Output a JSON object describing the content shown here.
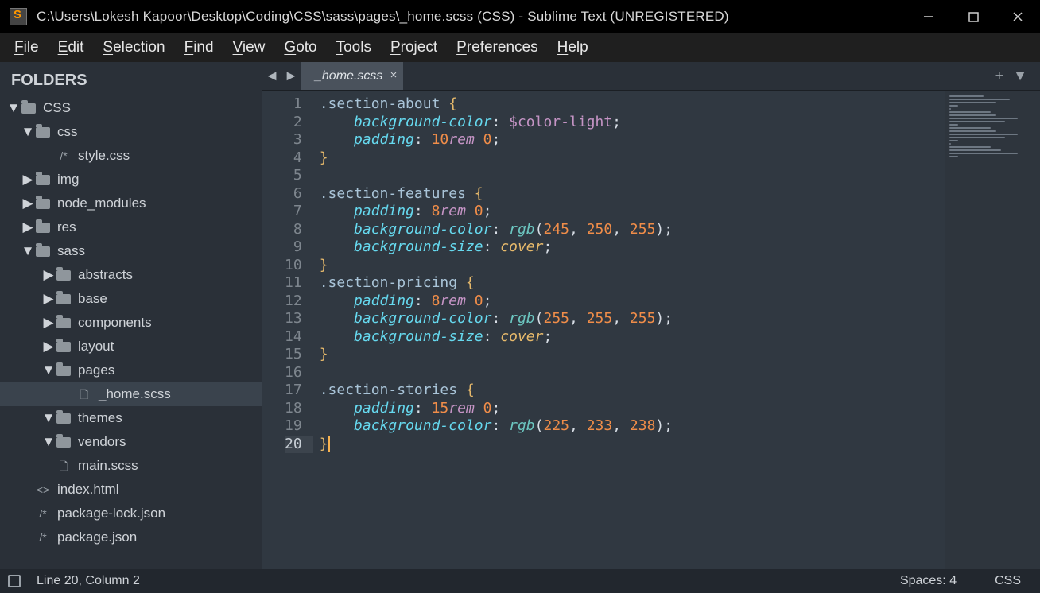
{
  "title": "C:\\Users\\Lokesh Kapoor\\Desktop\\Coding\\CSS\\sass\\pages\\_home.scss (CSS) - Sublime Text (UNREGISTERED)",
  "menu": [
    "File",
    "Edit",
    "Selection",
    "Find",
    "View",
    "Goto",
    "Tools",
    "Project",
    "Preferences",
    "Help"
  ],
  "sidebar": {
    "header": "FOLDERS",
    "tree": [
      {
        "d": 0,
        "k": "fo",
        "label": "CSS"
      },
      {
        "d": 1,
        "k": "fo",
        "label": "css"
      },
      {
        "d": 2,
        "k": "cm",
        "label": "style.css"
      },
      {
        "d": 1,
        "k": "fc",
        "label": "img"
      },
      {
        "d": 1,
        "k": "fc",
        "label": "node_modules"
      },
      {
        "d": 1,
        "k": "fc",
        "label": "res"
      },
      {
        "d": 1,
        "k": "fo",
        "label": "sass"
      },
      {
        "d": 2,
        "k": "fc",
        "label": "abstracts"
      },
      {
        "d": 2,
        "k": "fc",
        "label": "base"
      },
      {
        "d": 2,
        "k": "fc",
        "label": "components"
      },
      {
        "d": 2,
        "k": "fc",
        "label": "layout"
      },
      {
        "d": 2,
        "k": "fo",
        "label": "pages"
      },
      {
        "d": 3,
        "k": "fi",
        "label": "_home.scss",
        "sel": true
      },
      {
        "d": 2,
        "k": "fo",
        "label": "themes"
      },
      {
        "d": 2,
        "k": "fo",
        "label": "vendors"
      },
      {
        "d": 2,
        "k": "fi",
        "label": "main.scss"
      },
      {
        "d": 1,
        "k": "hx",
        "label": "index.html"
      },
      {
        "d": 1,
        "k": "cm",
        "label": "package-lock.json"
      },
      {
        "d": 1,
        "k": "cm",
        "label": "package.json"
      }
    ]
  },
  "tab": {
    "label": "_home.scss"
  },
  "tabactions": {
    "plus": "+",
    "down": "▼"
  },
  "code": {
    "lines": [
      [
        {
          "c": "sel",
          "t": ".section-about"
        },
        {
          "c": "punct",
          "t": " "
        },
        {
          "c": "brace",
          "t": "{"
        }
      ],
      [
        {
          "c": "punct",
          "t": "    "
        },
        {
          "c": "prop",
          "t": "background-color"
        },
        {
          "c": "punct",
          "t": ": "
        },
        {
          "c": "var",
          "t": "$color-light"
        },
        {
          "c": "punct",
          "t": ";"
        }
      ],
      [
        {
          "c": "punct",
          "t": "    "
        },
        {
          "c": "prop",
          "t": "padding"
        },
        {
          "c": "punct",
          "t": ": "
        },
        {
          "c": "num",
          "t": "10"
        },
        {
          "c": "unit",
          "t": "rem"
        },
        {
          "c": "punct",
          "t": " "
        },
        {
          "c": "num",
          "t": "0"
        },
        {
          "c": "punct",
          "t": ";"
        }
      ],
      [
        {
          "c": "brace",
          "t": "}"
        }
      ],
      [],
      [
        {
          "c": "sel",
          "t": ".section-features"
        },
        {
          "c": "punct",
          "t": " "
        },
        {
          "c": "brace",
          "t": "{"
        }
      ],
      [
        {
          "c": "punct",
          "t": "    "
        },
        {
          "c": "prop",
          "t": "padding"
        },
        {
          "c": "punct",
          "t": ": "
        },
        {
          "c": "num",
          "t": "8"
        },
        {
          "c": "unit",
          "t": "rem"
        },
        {
          "c": "punct",
          "t": " "
        },
        {
          "c": "num",
          "t": "0"
        },
        {
          "c": "punct",
          "t": ";"
        }
      ],
      [
        {
          "c": "punct",
          "t": "    "
        },
        {
          "c": "prop",
          "t": "background-color"
        },
        {
          "c": "punct",
          "t": ": "
        },
        {
          "c": "fn",
          "t": "rgb"
        },
        {
          "c": "punct",
          "t": "("
        },
        {
          "c": "num",
          "t": "245"
        },
        {
          "c": "punct",
          "t": ", "
        },
        {
          "c": "num",
          "t": "250"
        },
        {
          "c": "punct",
          "t": ", "
        },
        {
          "c": "num",
          "t": "255"
        },
        {
          "c": "punct",
          "t": ");"
        }
      ],
      [
        {
          "c": "punct",
          "t": "    "
        },
        {
          "c": "prop",
          "t": "background-size"
        },
        {
          "c": "punct",
          "t": ": "
        },
        {
          "c": "kw",
          "t": "cover"
        },
        {
          "c": "punct",
          "t": ";"
        }
      ],
      [
        {
          "c": "brace",
          "t": "}"
        }
      ],
      [
        {
          "c": "sel",
          "t": ".section-pricing"
        },
        {
          "c": "punct",
          "t": " "
        },
        {
          "c": "brace",
          "t": "{"
        }
      ],
      [
        {
          "c": "punct",
          "t": "    "
        },
        {
          "c": "prop",
          "t": "padding"
        },
        {
          "c": "punct",
          "t": ": "
        },
        {
          "c": "num",
          "t": "8"
        },
        {
          "c": "unit",
          "t": "rem"
        },
        {
          "c": "punct",
          "t": " "
        },
        {
          "c": "num",
          "t": "0"
        },
        {
          "c": "punct",
          "t": ";"
        }
      ],
      [
        {
          "c": "punct",
          "t": "    "
        },
        {
          "c": "prop",
          "t": "background-color"
        },
        {
          "c": "punct",
          "t": ": "
        },
        {
          "c": "fn",
          "t": "rgb"
        },
        {
          "c": "punct",
          "t": "("
        },
        {
          "c": "num",
          "t": "255"
        },
        {
          "c": "punct",
          "t": ", "
        },
        {
          "c": "num",
          "t": "255"
        },
        {
          "c": "punct",
          "t": ", "
        },
        {
          "c": "num",
          "t": "255"
        },
        {
          "c": "punct",
          "t": ");"
        }
      ],
      [
        {
          "c": "punct",
          "t": "    "
        },
        {
          "c": "prop",
          "t": "background-size"
        },
        {
          "c": "punct",
          "t": ": "
        },
        {
          "c": "kw",
          "t": "cover"
        },
        {
          "c": "punct",
          "t": ";"
        }
      ],
      [
        {
          "c": "brace",
          "t": "}"
        }
      ],
      [],
      [
        {
          "c": "sel",
          "t": ".section-stories"
        },
        {
          "c": "punct",
          "t": " "
        },
        {
          "c": "brace",
          "t": "{"
        }
      ],
      [
        {
          "c": "punct",
          "t": "    "
        },
        {
          "c": "prop",
          "t": "padding"
        },
        {
          "c": "punct",
          "t": ": "
        },
        {
          "c": "num",
          "t": "15"
        },
        {
          "c": "unit",
          "t": "rem"
        },
        {
          "c": "punct",
          "t": " "
        },
        {
          "c": "num",
          "t": "0"
        },
        {
          "c": "punct",
          "t": ";"
        }
      ],
      [
        {
          "c": "punct",
          "t": "    "
        },
        {
          "c": "prop",
          "t": "background-color"
        },
        {
          "c": "punct",
          "t": ": "
        },
        {
          "c": "fn",
          "t": "rgb"
        },
        {
          "c": "punct",
          "t": "("
        },
        {
          "c": "num",
          "t": "225"
        },
        {
          "c": "punct",
          "t": ", "
        },
        {
          "c": "num",
          "t": "233"
        },
        {
          "c": "punct",
          "t": ", "
        },
        {
          "c": "num",
          "t": "238"
        },
        {
          "c": "punct",
          "t": ");"
        }
      ],
      [
        {
          "c": "brace",
          "t": "}"
        }
      ]
    ],
    "current_line": 20
  },
  "status": {
    "pos": "Line 20, Column 2",
    "spaces": "Spaces: 4",
    "lang": "CSS"
  }
}
